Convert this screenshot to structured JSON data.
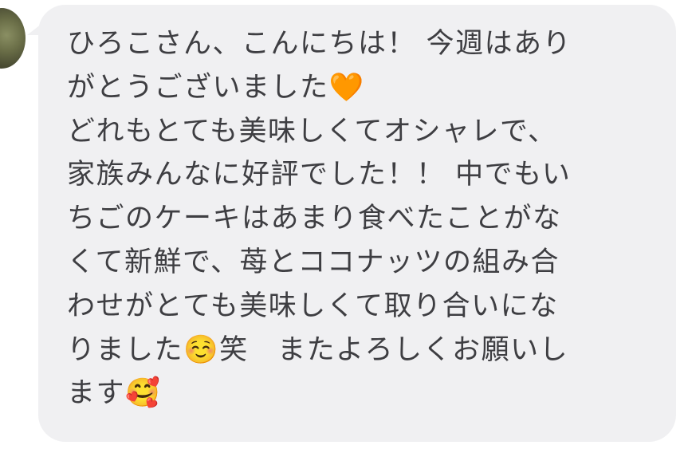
{
  "message": {
    "lines": [
      "ひろこさん、こんにちは！ 今週はあり",
      "がとうございました🧡",
      "どれもとても美味しくてオシャレで、",
      "家族みんなに好評でした！！ 中でもい",
      "ちごのケーキはあまり食べたことがな",
      "くて新鮮で、苺とココナッツの組み合",
      "わせがとても美味しくて取り合いにな",
      "りました☺️笑　またよろしくお願いし",
      "ます🥰"
    ]
  },
  "colors": {
    "bubble": "#f0f0f2",
    "text": "#3e3e42"
  },
  "icons": {
    "avatar": "profile-avatar"
  }
}
